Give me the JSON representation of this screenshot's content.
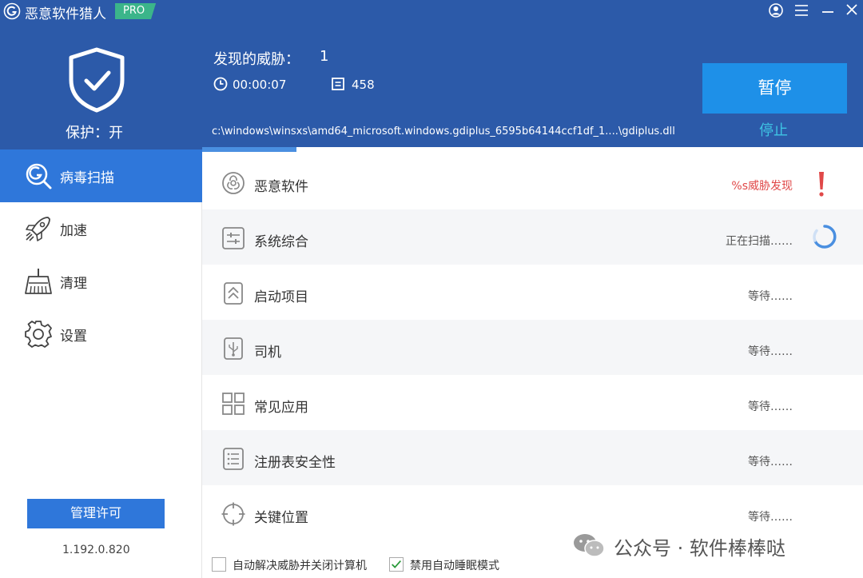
{
  "app": {
    "title": "恶意软件猎人",
    "badge": "PRO"
  },
  "header": {
    "protection_label": "保护：开",
    "threats_label": "发现的威胁：",
    "threats_count": "1",
    "elapsed_time": "00:00:07",
    "files_scanned": "458",
    "current_file": "c:\\windows\\winsxs\\amd64_microsoft.windows.gdiplus_6595b64144ccf1df_1....\\gdiplus.dll",
    "pause_label": "暂停",
    "stop_label": "停止",
    "progress_fraction": 0.143
  },
  "sidebar": {
    "items": [
      {
        "label": "病毒扫描",
        "icon": "scan-icon",
        "active": true
      },
      {
        "label": "加速",
        "icon": "rocket-icon",
        "active": false
      },
      {
        "label": "清理",
        "icon": "broom-icon",
        "active": false
      },
      {
        "label": "设置",
        "icon": "gear-icon",
        "active": false
      }
    ],
    "license_label": "管理许可",
    "version": "1.192.0.820"
  },
  "scan_items": [
    {
      "label": "恶意软件",
      "status": "%s威胁发现",
      "icon": "biohazard-icon"
    },
    {
      "label": "系统综合",
      "status": "正在扫描……",
      "icon": "sliders-icon"
    },
    {
      "label": "启动项目",
      "status": "等待……",
      "icon": "startup-icon"
    },
    {
      "label": "司机",
      "status": "等待……",
      "icon": "usb-icon"
    },
    {
      "label": "常见应用",
      "status": "等待……",
      "icon": "apps-grid-icon"
    },
    {
      "label": "注册表安全性",
      "status": "等待……",
      "icon": "registry-list-icon"
    },
    {
      "label": "关键位置",
      "status": "等待……",
      "icon": "crosshair-icon"
    }
  ],
  "options": [
    {
      "label": "自动解决威胁并关闭计算机",
      "checked": false
    },
    {
      "label": "禁用自动睡眠模式",
      "checked": true
    }
  ],
  "watermark": "公众号 · 软件棒棒哒",
  "colors": {
    "header_bg": "#2c5aa9",
    "accent": "#2f77da",
    "pause_btn": "#1e90e8",
    "stop_link": "#3ec4e4",
    "threat_red": "#e04848",
    "pro_badge": "#3bb58a"
  }
}
